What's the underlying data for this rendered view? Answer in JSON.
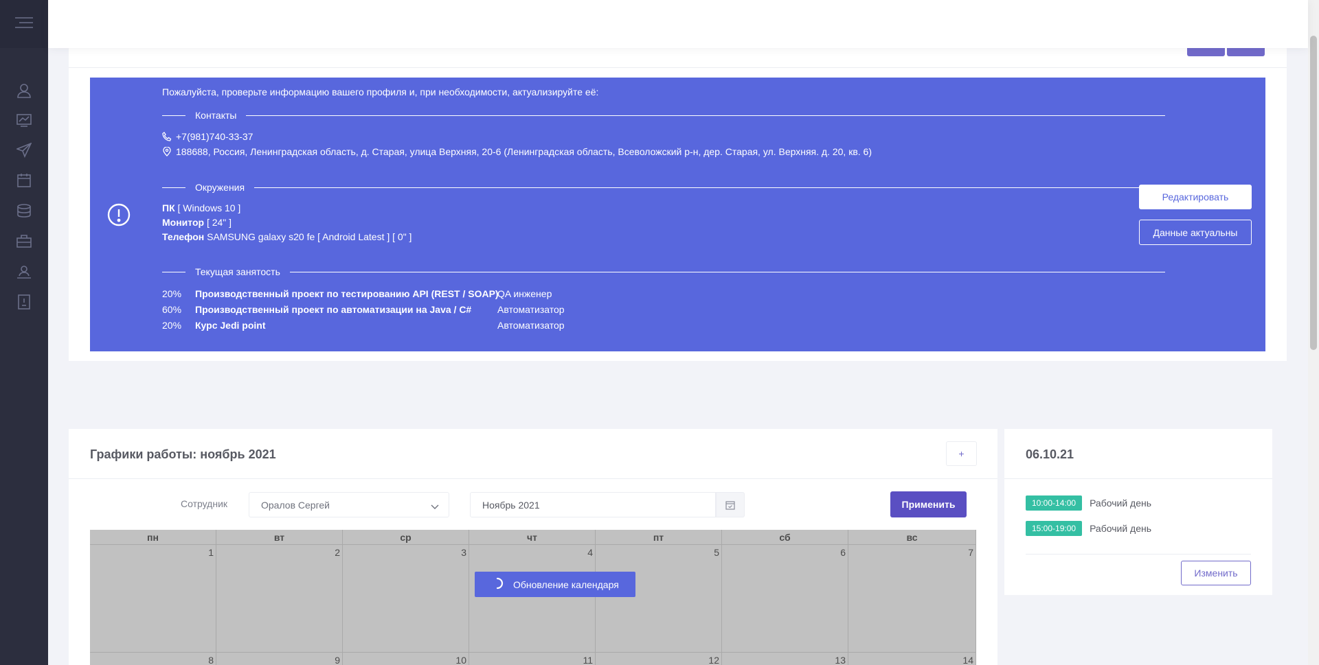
{
  "colors": {
    "accent": "#5867dd",
    "primary": "#5a4fc2",
    "success": "#34bfa3",
    "sidebar": "#2c2e3e"
  },
  "sidebar": {
    "items": [
      {
        "icon": "user-icon"
      },
      {
        "icon": "chart-icon"
      },
      {
        "icon": "send-icon"
      },
      {
        "icon": "calendar-icon"
      },
      {
        "icon": "stack-icon"
      },
      {
        "icon": "briefcase-icon"
      },
      {
        "icon": "user-board-icon"
      },
      {
        "icon": "document-icon"
      }
    ]
  },
  "profile_alert": {
    "intro": "Пожалуйста, проверьте информацию вашего профиля и, при необходимости, актуализируйте её:",
    "contacts": {
      "title": "Контакты",
      "phone": "+7(981)740-33-37",
      "address": "188688, Россия, Ленинградская область, д. Старая, улица Верхняя, 20-6 (Ленинградская область, Всеволожский р-н, дер. Старая, ул. Верхняя. д. 20, кв. 6)"
    },
    "environment": {
      "title": "Окружения",
      "items": [
        {
          "name": "ПК",
          "value": "[ Windows 10 ]"
        },
        {
          "name": "Монитор",
          "value": "[ 24\" ]"
        },
        {
          "name": "Телефон",
          "value": "SAMSUNG galaxy s20 fe [ Android Latest ] [ 0\" ]"
        }
      ]
    },
    "employment": {
      "title": "Текущая занятость",
      "rows": [
        {
          "pct": "20%",
          "project": "Производственный проект по тестированию API (REST / SOAP)",
          "role": "QA инженер"
        },
        {
          "pct": "60%",
          "project": "Производственный проект по автоматизации на Java / C#",
          "role": "Автоматизатор"
        },
        {
          "pct": "20%",
          "project": "Курс Jedi point",
          "role": "Автоматизатор"
        }
      ]
    },
    "edit_label": "Редактировать",
    "confirm_label": "Данные актуальны"
  },
  "schedule": {
    "title": "Графики работы: ноябрь 2021",
    "add_label": "+",
    "employee_label": "Сотрудник",
    "employee_value": "Оралов Сергей",
    "month_value": "Ноябрь 2021",
    "apply_label": "Применить",
    "loading_text": "Обновление календаря",
    "weekdays": [
      "пн",
      "вт",
      "ср",
      "чт",
      "пт",
      "сб",
      "вс"
    ],
    "week1": [
      "1",
      "2",
      "3",
      "4",
      "5",
      "6",
      "7"
    ],
    "week2": [
      "8",
      "9",
      "10",
      "11",
      "12",
      "13",
      "14"
    ]
  },
  "day_panel": {
    "date": "06.10.21",
    "slots": [
      {
        "time": "10:00-14:00",
        "label": "Рабочий день"
      },
      {
        "time": "15:00-19:00",
        "label": "Рабочий день"
      }
    ],
    "change_label": "Изменить"
  }
}
